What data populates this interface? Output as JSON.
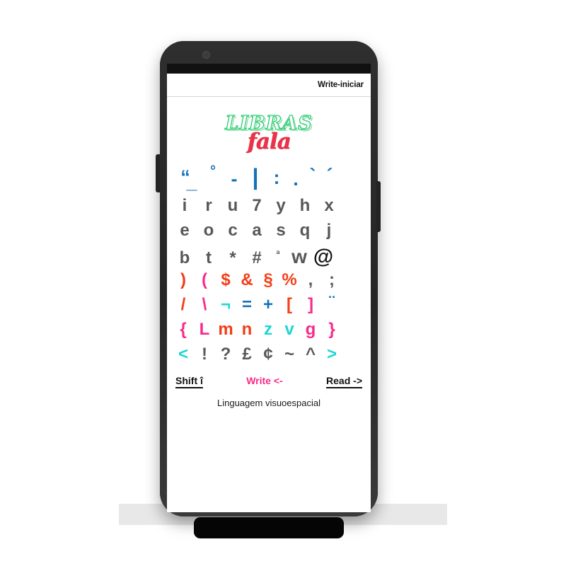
{
  "app": {
    "header_title": "Write-iniciar",
    "logo_primary": "LIBRAS",
    "logo_secondary": "fala",
    "tagline": "Linguagem visuoespacial"
  },
  "colors": {
    "blue": "#1572b8",
    "gray": "#58585a",
    "red": "#f43d18",
    "pink": "#f72a8a",
    "cyan": "#1ed6d6",
    "logo_green": "#2ecc71",
    "logo_red": "#e8334a",
    "black": "#111111"
  },
  "keyboard": {
    "rows": [
      {
        "id": "symbols",
        "keys": [
          {
            "char": "“",
            "color": "blue"
          },
          {
            "char": "_",
            "color": "blue"
          },
          {
            "char": "°",
            "color": "blue"
          },
          {
            "char": "-",
            "color": "blue"
          },
          {
            "char": "|",
            "color": "blue"
          },
          {
            "char": ":",
            "color": "blue"
          },
          {
            "char": ".",
            "color": "blue"
          },
          {
            "char": "`",
            "color": "blue"
          },
          {
            "char": "´",
            "color": "blue"
          }
        ]
      },
      {
        "id": "letters-1",
        "keys": [
          {
            "char": "i",
            "color": "gray"
          },
          {
            "char": "r",
            "color": "gray"
          },
          {
            "char": "u",
            "color": "gray"
          },
          {
            "char": "7",
            "color": "gray"
          },
          {
            "char": "y",
            "color": "gray"
          },
          {
            "char": "h",
            "color": "gray"
          },
          {
            "char": "x",
            "color": "gray"
          }
        ]
      },
      {
        "id": "letters-2",
        "keys": [
          {
            "char": "e",
            "color": "gray"
          },
          {
            "char": "o",
            "color": "gray"
          },
          {
            "char": "c",
            "color": "gray"
          },
          {
            "char": "a",
            "color": "gray"
          },
          {
            "char": "s",
            "color": "gray"
          },
          {
            "char": "q",
            "color": "gray"
          },
          {
            "char": "j",
            "color": "gray"
          }
        ]
      },
      {
        "id": "letters-3",
        "keys": [
          {
            "char": "b",
            "color": "gray"
          },
          {
            "char": "t",
            "color": "gray"
          },
          {
            "char": "*",
            "color": "gray"
          },
          {
            "char": "#",
            "color": "gray"
          },
          {
            "char": "ª",
            "color": "gray"
          },
          {
            "char": "w",
            "color": "gray"
          },
          {
            "char": "@",
            "color": "black"
          }
        ]
      },
      {
        "id": "paren",
        "keys": [
          {
            "char": ")",
            "color": "red"
          },
          {
            "char": "(",
            "color": "pink"
          },
          {
            "char": "$",
            "color": "red"
          },
          {
            "char": "&",
            "color": "red"
          },
          {
            "char": "§",
            "color": "red"
          },
          {
            "char": "%",
            "color": "red"
          },
          {
            "char": ",",
            "color": "gray"
          },
          {
            "char": ";",
            "color": "gray"
          }
        ]
      },
      {
        "id": "slash",
        "keys": [
          {
            "char": "/",
            "color": "red"
          },
          {
            "char": "\\",
            "color": "pink"
          },
          {
            "char": "¬",
            "color": "cyan"
          },
          {
            "char": "=",
            "color": "blue"
          },
          {
            "char": "+",
            "color": "blue"
          },
          {
            "char": "[",
            "color": "red"
          },
          {
            "char": "]",
            "color": "pink"
          },
          {
            "char": "¨",
            "color": "blue"
          }
        ]
      },
      {
        "id": "brace",
        "keys": [
          {
            "char": "{",
            "color": "pink"
          },
          {
            "char": "L",
            "color": "pink"
          },
          {
            "char": "m",
            "color": "red"
          },
          {
            "char": "n",
            "color": "red"
          },
          {
            "char": "z",
            "color": "cyan"
          },
          {
            "char": "v",
            "color": "cyan"
          },
          {
            "char": "g",
            "color": "pink"
          },
          {
            "char": "}",
            "color": "pink"
          }
        ]
      },
      {
        "id": "angle",
        "keys": [
          {
            "char": "<",
            "color": "cyan"
          },
          {
            "char": "!",
            "color": "gray"
          },
          {
            "char": "?",
            "color": "gray"
          },
          {
            "char": "£",
            "color": "gray"
          },
          {
            "char": "¢",
            "color": "gray"
          },
          {
            "char": "~",
            "color": "gray"
          },
          {
            "char": "^",
            "color": "gray"
          },
          {
            "char": ">",
            "color": "cyan"
          }
        ]
      }
    ]
  },
  "actions": {
    "shift": "Shift î",
    "write": "Write <-",
    "read": "Read ->"
  }
}
